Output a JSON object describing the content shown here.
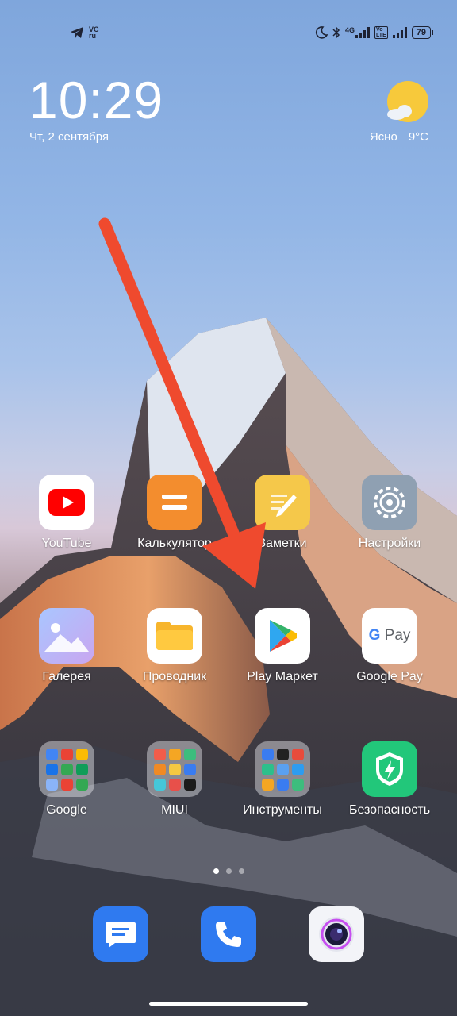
{
  "status_bar": {
    "left_badge": [
      "VC",
      "ru"
    ],
    "net_type": "4G",
    "volte_badge": [
      "Vo",
      "LTE"
    ],
    "battery": "79"
  },
  "lockscreen": {
    "time": "10:29",
    "date": "Чт, 2 сентября",
    "weather_condition": "Ясно",
    "temperature": "9°C"
  },
  "apps": [
    {
      "label": "YouTube"
    },
    {
      "label": "Калькулятор"
    },
    {
      "label": "Заметки"
    },
    {
      "label": "Настройки"
    },
    {
      "label": "Галерея"
    },
    {
      "label": "Проводник"
    },
    {
      "label": "Play Маркет"
    },
    {
      "label": "Google Pay"
    },
    {
      "label": "Google"
    },
    {
      "label": "MIUI"
    },
    {
      "label": "Инструменты"
    },
    {
      "label": "Безопасность"
    }
  ],
  "google_pay_logo": {
    "g": "G",
    "pay": "Pay"
  },
  "pages": {
    "count": 3,
    "current": 1
  },
  "dock": [
    {
      "icon": "messages-icon"
    },
    {
      "icon": "phone-icon"
    },
    {
      "icon": "camera-icon"
    }
  ],
  "colors": {
    "arrow": "#ef4a2e",
    "youtube": "#ff0000",
    "calculator": "#f38d2e",
    "security": "#22c77a"
  }
}
